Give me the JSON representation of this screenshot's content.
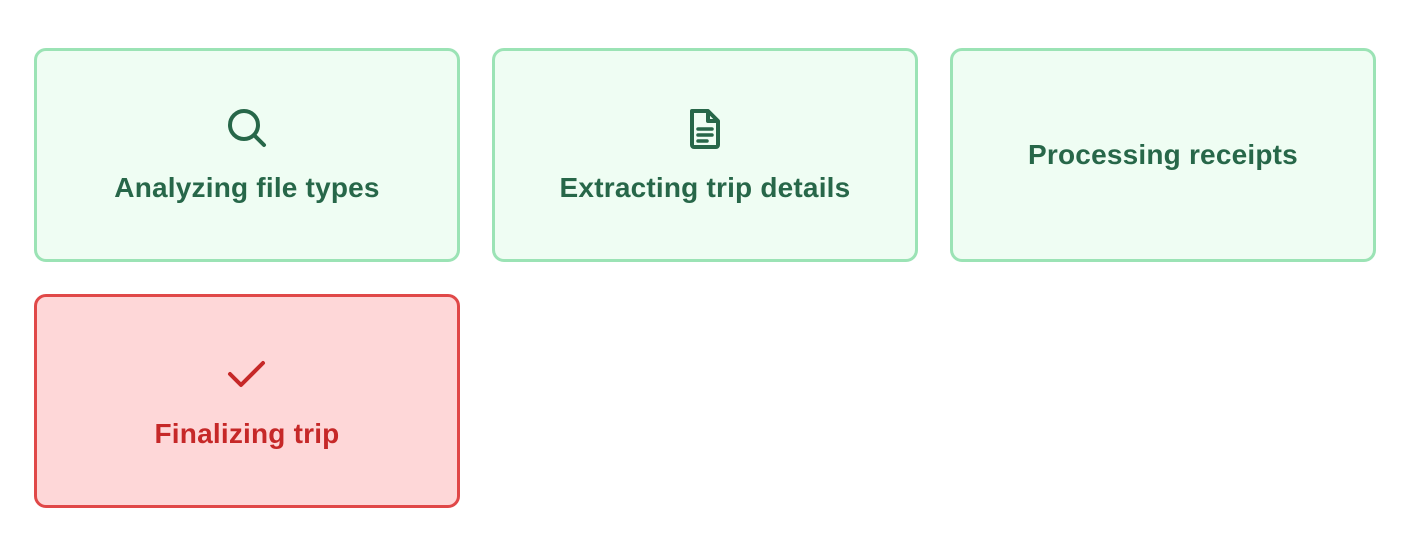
{
  "steps": [
    {
      "label": "Analyzing file types",
      "icon": "search-icon",
      "status": "done"
    },
    {
      "label": "Extracting trip details",
      "icon": "document-icon",
      "status": "done"
    },
    {
      "label": "Processing receipts",
      "icon": "",
      "status": "done"
    },
    {
      "label": "Finalizing trip",
      "icon": "check-icon",
      "status": "error"
    }
  ],
  "colors": {
    "success_border": "#9be3b5",
    "success_bg": "#effdf3",
    "success_text": "#276749",
    "error_border": "#e04848",
    "error_bg": "#fed7d8",
    "error_text": "#c62828"
  }
}
